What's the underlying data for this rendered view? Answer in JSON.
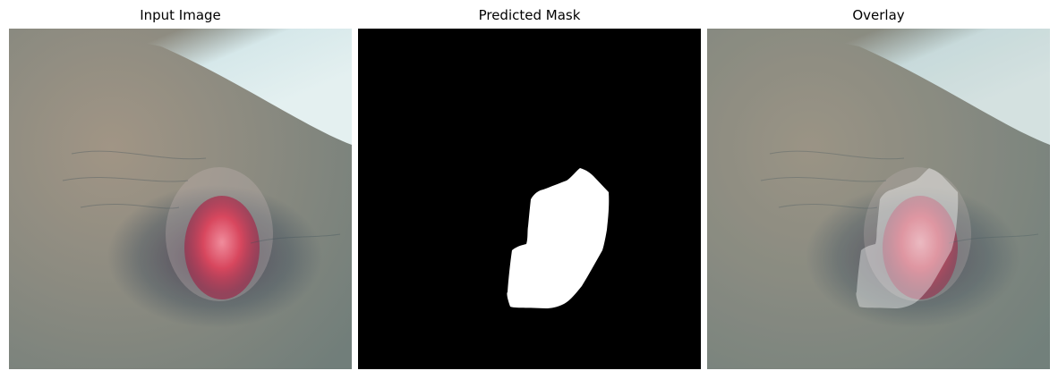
{
  "panels": [
    {
      "title": "Input Image"
    },
    {
      "title": "Predicted Mask"
    },
    {
      "title": "Overlay"
    }
  ],
  "colors": {
    "mask_fg": "#ffffff",
    "mask_bg": "#000000",
    "lesion": "#d8475e",
    "skin": "#8c8a80"
  }
}
